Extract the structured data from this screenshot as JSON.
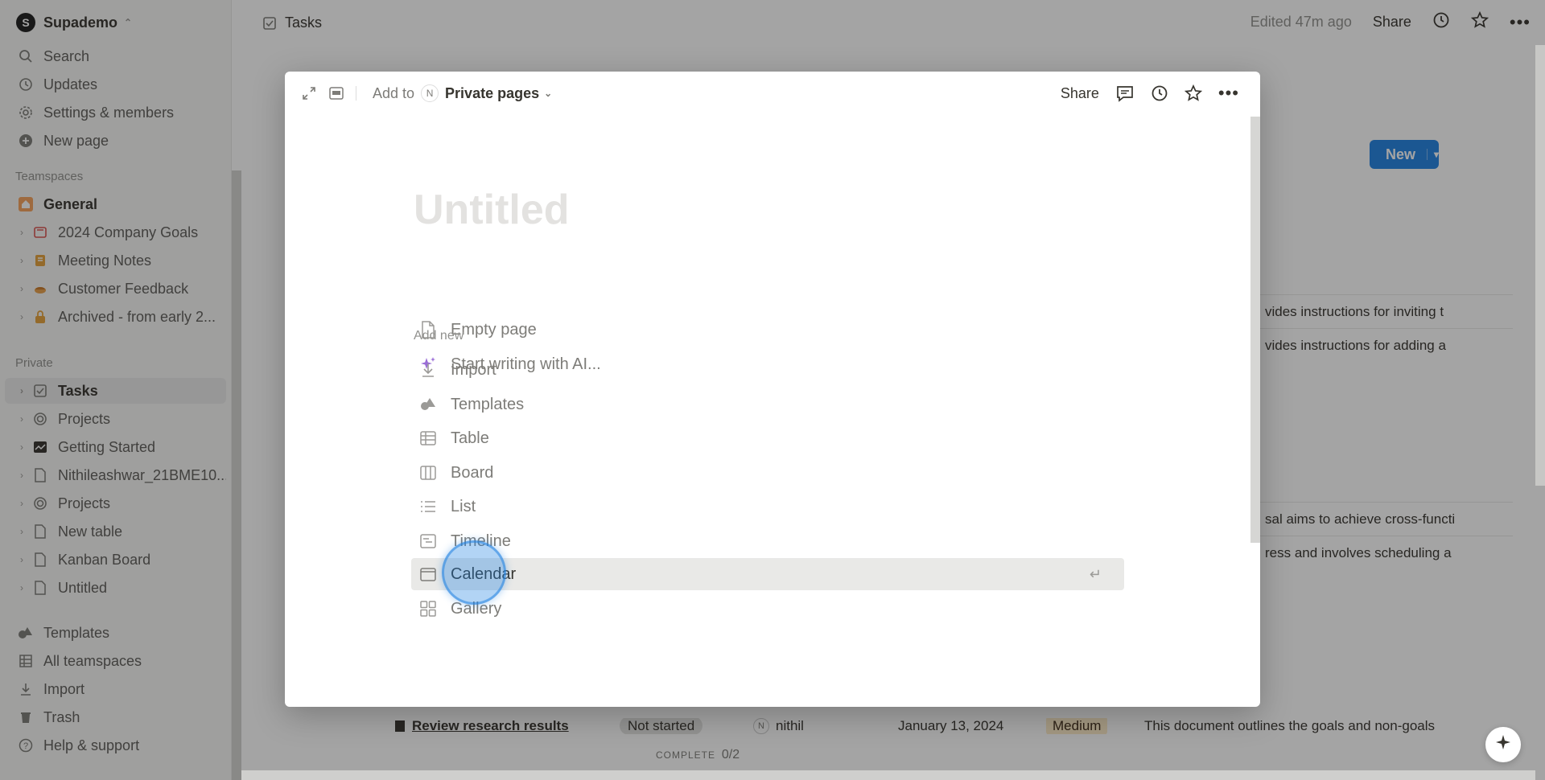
{
  "workspace": {
    "initial": "S",
    "name": "Supademo"
  },
  "sidebar": {
    "top_items": [
      {
        "label": "Search",
        "icon": "search-icon"
      },
      {
        "label": "Updates",
        "icon": "clock-icon"
      },
      {
        "label": "Settings & members",
        "icon": "gear-icon"
      },
      {
        "label": "New page",
        "icon": "plus-circle-icon"
      }
    ],
    "teamspaces_heading": "Teamspaces",
    "teamspaces": [
      {
        "label": "General",
        "icon": "house-icon"
      },
      {
        "label": "2024 Company Goals",
        "icon": "mountain-icon"
      },
      {
        "label": "Meeting Notes",
        "icon": "notebook-icon"
      },
      {
        "label": "Customer Feedback",
        "icon": "pie-icon"
      },
      {
        "label": "Archived - from early 2...",
        "icon": "lock-icon"
      }
    ],
    "private_heading": "Private",
    "private": [
      {
        "label": "Tasks",
        "icon": "checkbox-icon"
      },
      {
        "label": "Projects",
        "icon": "target-icon"
      },
      {
        "label": "Getting Started",
        "icon": "chart-icon"
      },
      {
        "label": "Nithileashwar_21BME10...",
        "icon": "page-icon"
      },
      {
        "label": "Projects",
        "icon": "target-icon"
      },
      {
        "label": "New table",
        "icon": "page-icon"
      },
      {
        "label": "Kanban Board",
        "icon": "page-icon"
      },
      {
        "label": "Untitled",
        "icon": "page-icon"
      }
    ],
    "bottom_items": [
      {
        "label": "Templates",
        "icon": "shapes-icon"
      },
      {
        "label": "All teamspaces",
        "icon": "grid-icon"
      },
      {
        "label": "Import",
        "icon": "download-icon"
      },
      {
        "label": "Trash",
        "icon": "trash-icon"
      },
      {
        "label": "Help & support",
        "icon": "help-icon"
      }
    ]
  },
  "topbar": {
    "title": "Tasks",
    "edited": "Edited 47m ago",
    "share": "Share"
  },
  "background": {
    "new_button": "New",
    "rows": [
      {
        "text": "vides instructions for inviting t"
      },
      {
        "text": "vides instructions for adding a"
      },
      {
        "text": "sal aims to achieve cross-functi"
      },
      {
        "text": "ress and involves scheduling a"
      }
    ],
    "task_row": {
      "name": "Review research results",
      "status": "Not started",
      "assignee_initial": "N",
      "assignee": "nithil",
      "date": "January 13, 2024",
      "priority": "Medium",
      "summary": "This document outlines the goals and non-goals"
    },
    "complete_label": "COMPLETE",
    "complete_value": "0/2"
  },
  "modal": {
    "add_to": "Add to",
    "location_initial": "N",
    "location": "Private pages",
    "share": "Share",
    "title_placeholder": "Untitled",
    "options": [
      {
        "label": "Empty page",
        "icon": "page-icon"
      },
      {
        "label": "Start writing with AI...",
        "icon": "sparkle-icon"
      }
    ],
    "add_new_heading": "Add new",
    "add_new": [
      {
        "label": "Import",
        "icon": "download-icon"
      },
      {
        "label": "Templates",
        "icon": "shapes-icon"
      },
      {
        "label": "Table",
        "icon": "table-icon"
      },
      {
        "label": "Board",
        "icon": "board-icon"
      },
      {
        "label": "List",
        "icon": "list-icon"
      },
      {
        "label": "Timeline",
        "icon": "timeline-icon"
      },
      {
        "label": "Calendar",
        "icon": "calendar-icon"
      },
      {
        "label": "Gallery",
        "icon": "gallery-icon"
      }
    ],
    "selected": "Calendar",
    "accent": "#2383e2"
  }
}
